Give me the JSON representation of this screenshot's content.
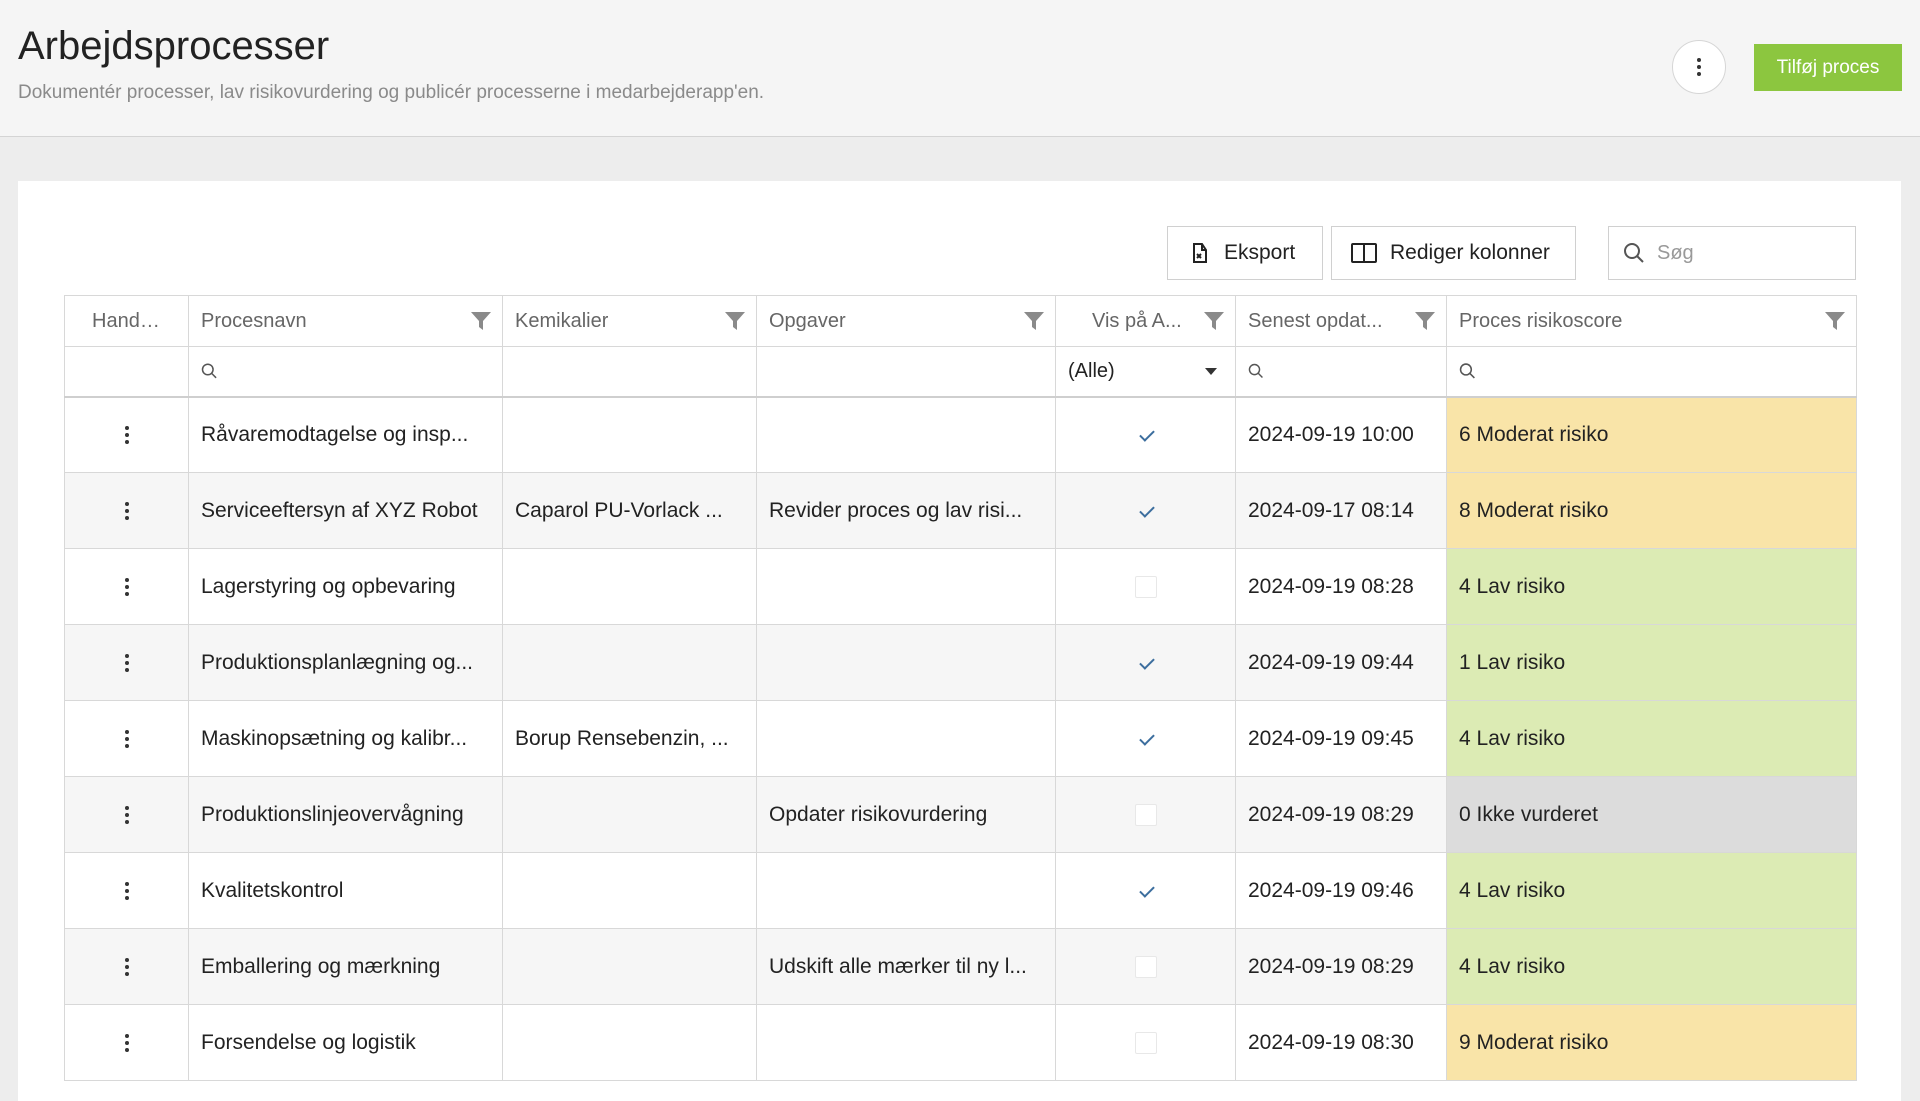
{
  "header": {
    "title": "Arbejdsprocesser",
    "subtitle": "Dokumentér processer, lav risikovurdering og publicér processerne i medarbejderapp'en.",
    "add_button": "Tilføj proces"
  },
  "toolbar": {
    "export_label": "Eksport",
    "edit_columns_label": "Rediger kolonner",
    "search_placeholder": "Søg"
  },
  "table": {
    "columns": [
      "Handling",
      "Procesnavn",
      "Kemikalier",
      "Opgaver",
      "Vis på A...",
      "Senest opdat...",
      "Proces risikoscore"
    ],
    "visibility_filter": "(Alle)",
    "rows": [
      {
        "name": "Råvaremodtagelse og insp...",
        "chemicals": "",
        "tasks": "",
        "visible": true,
        "updated": "2024-09-19 10:00",
        "risk": "6 Moderat risiko",
        "risk_level": "moderate"
      },
      {
        "name": "Serviceeftersyn af XYZ Robot",
        "chemicals": "Caparol PU-Vorlack ...",
        "tasks": "Revider proces og lav risi...",
        "visible": true,
        "updated": "2024-09-17 08:14",
        "risk": "8 Moderat risiko",
        "risk_level": "moderate"
      },
      {
        "name": "Lagerstyring og opbevaring",
        "chemicals": "",
        "tasks": "",
        "visible": false,
        "updated": "2024-09-19 08:28",
        "risk": "4 Lav risiko",
        "risk_level": "low"
      },
      {
        "name": "Produktionsplanlægning og...",
        "chemicals": "",
        "tasks": "",
        "visible": true,
        "updated": "2024-09-19 09:44",
        "risk": "1 Lav risiko",
        "risk_level": "low"
      },
      {
        "name": "Maskinopsætning og kalibr...",
        "chemicals": "Borup Rensebenzin, ...",
        "tasks": "",
        "visible": true,
        "updated": "2024-09-19 09:45",
        "risk": "4 Lav risiko",
        "risk_level": "low"
      },
      {
        "name": "Produktionslinjeovervågning",
        "chemicals": "",
        "tasks": "Opdater risikovurdering",
        "visible": false,
        "updated": "2024-09-19 08:29",
        "risk": "0 Ikke vurderet",
        "risk_level": "none"
      },
      {
        "name": "Kvalitetskontrol",
        "chemicals": "",
        "tasks": "",
        "visible": true,
        "updated": "2024-09-19 09:46",
        "risk": "4 Lav risiko",
        "risk_level": "low"
      },
      {
        "name": "Emballering og mærkning",
        "chemicals": "",
        "tasks": "Udskift alle mærker til ny l...",
        "visible": false,
        "updated": "2024-09-19 08:29",
        "risk": "4 Lav risiko",
        "risk_level": "low"
      },
      {
        "name": "Forsendelse og logistik",
        "chemicals": "",
        "tasks": "",
        "visible": false,
        "updated": "2024-09-19 08:30",
        "risk": "9 Moderat risiko",
        "risk_level": "moderate"
      }
    ]
  },
  "colors": {
    "accent": "#8cc63f",
    "risk_moderate": "#f9e4a8",
    "risk_low": "#dcebb4",
    "risk_none": "#dcdcdc",
    "check": "#3c6e9e"
  }
}
